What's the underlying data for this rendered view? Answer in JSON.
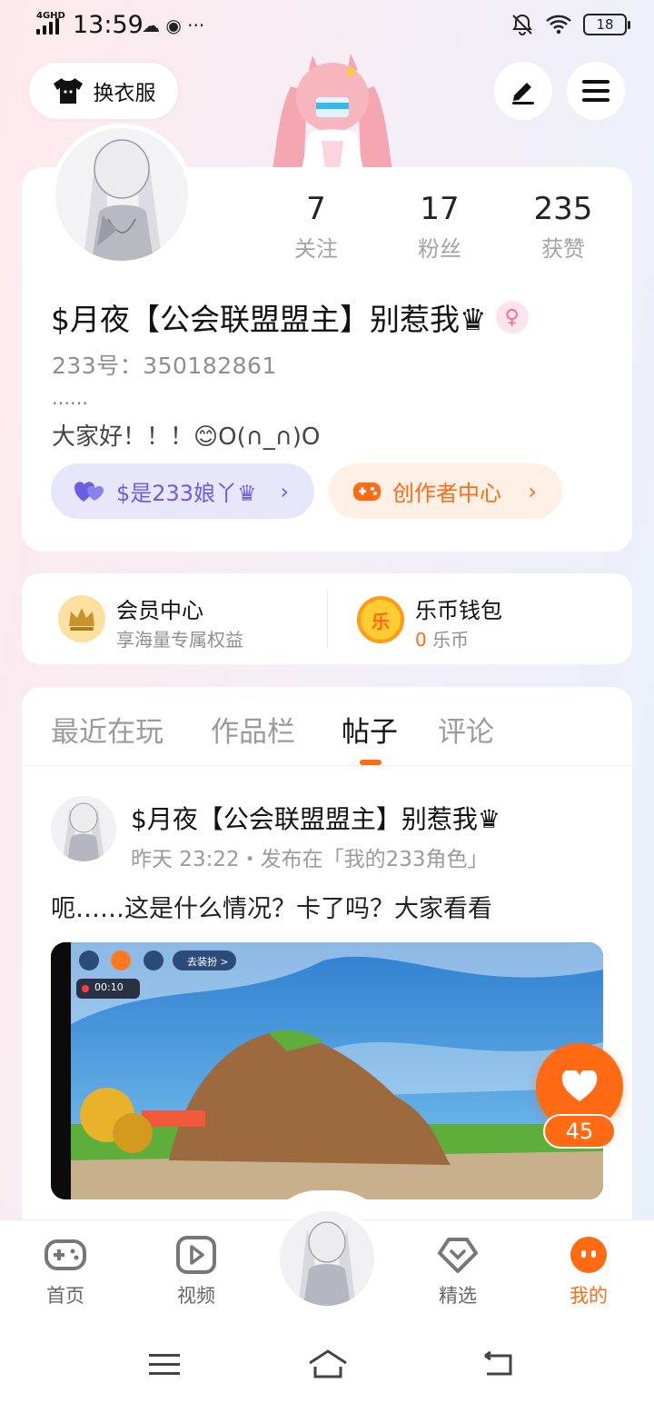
{
  "status_bar": {
    "network": "4GHD",
    "time": "13:59",
    "extras": "☁ ◉ ···",
    "battery": "18"
  },
  "header": {
    "outfit_label": "换衣服"
  },
  "profile": {
    "stats": [
      {
        "value": "7",
        "label": "关注"
      },
      {
        "value": "17",
        "label": "粉丝"
      },
      {
        "value": "235",
        "label": "获赞"
      }
    ],
    "nickname": "$月夜【公会联盟盟主】别惹我♛",
    "uid": "233号：350182861",
    "bio_line1": "……",
    "bio_line2": "大家好！！！😊O(∩_∩)O",
    "pill_relation": "$是233娘丫♛",
    "pill_creator": "创作者中心"
  },
  "wallet": {
    "vip_title": "会员中心",
    "vip_sub": "享海量专属权益",
    "coin_badge": "乐",
    "coin_title": "乐币钱包",
    "coin_amount": "0",
    "coin_unit": "乐币"
  },
  "tabs": [
    {
      "label": "最近在玩",
      "active": false
    },
    {
      "label": "作品栏",
      "active": false
    },
    {
      "label": "帖子",
      "active": true
    },
    {
      "label": "评论",
      "active": false
    }
  ],
  "post": {
    "author": "$月夜【公会联盟盟主】别惹我♛",
    "meta": "昨天 23:22・发布在「我的233角色」",
    "text": "呃……这是什么情况？卡了吗？大家看看",
    "media_timer": "00:10",
    "media_tag": "去装扮 >"
  },
  "like": {
    "count": "45"
  },
  "bottom_nav": [
    {
      "label": "首页",
      "icon": "gamepad-icon"
    },
    {
      "label": "视频",
      "icon": "video-icon"
    },
    {
      "label": "精选",
      "icon": "heart-diamond-icon"
    },
    {
      "label": "我的",
      "icon": "face-icon",
      "active": true
    }
  ],
  "colors": {
    "accent": "#ff6a13",
    "purple": "#6b5ee3"
  }
}
